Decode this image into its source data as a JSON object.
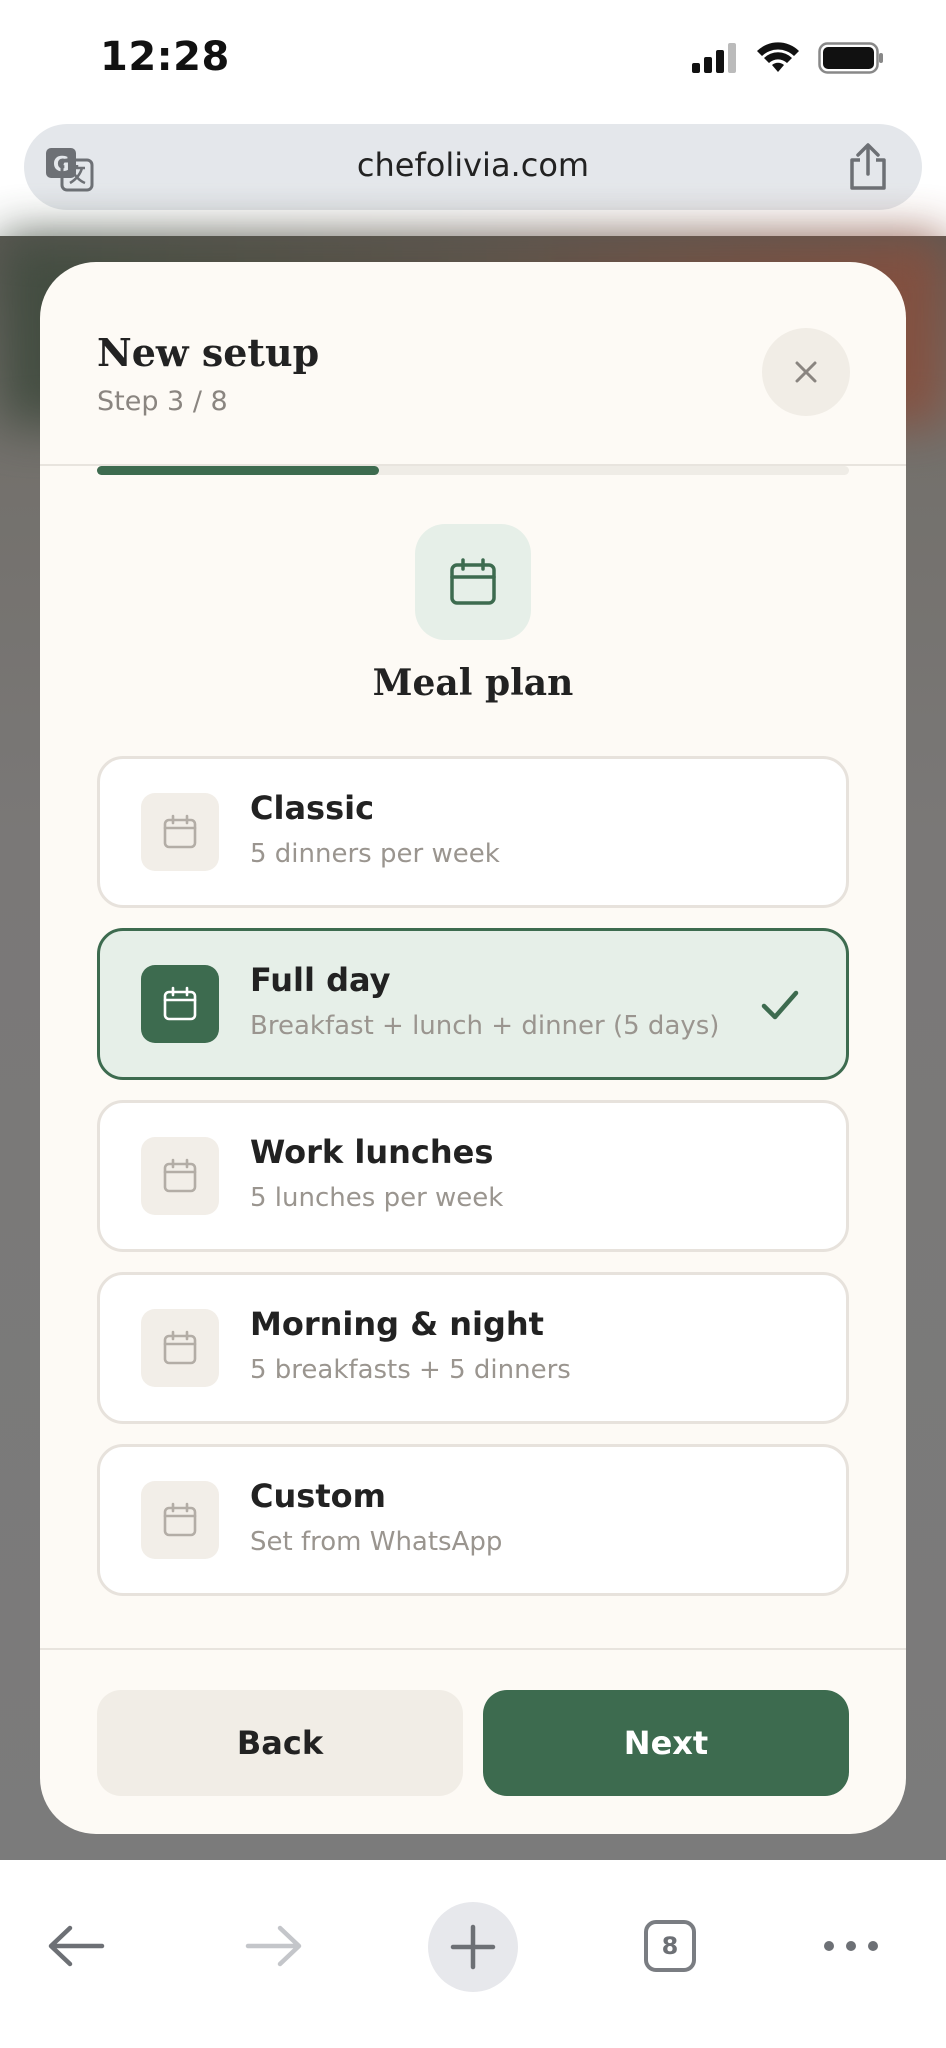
{
  "status_bar": {
    "time": "12:28"
  },
  "browser": {
    "url": "chefolivia.com",
    "tab_count": "8"
  },
  "modal": {
    "title": "New setup",
    "step": "Step 3 / 8",
    "progress_fraction": 0.375,
    "section_title": "Meal plan",
    "options": [
      {
        "title": "Classic",
        "subtitle": "5 dinners per week",
        "selected": false
      },
      {
        "title": "Full day",
        "subtitle": "Breakfast + lunch + dinner (5 days)",
        "selected": true
      },
      {
        "title": "Work lunches",
        "subtitle": "5 lunches per week",
        "selected": false
      },
      {
        "title": "Morning & night",
        "subtitle": "5 breakfasts + 5 dinners",
        "selected": false
      },
      {
        "title": "Custom",
        "subtitle": "Set from WhatsApp",
        "selected": false
      }
    ],
    "back_label": "Back",
    "next_label": "Next"
  },
  "colors": {
    "accent": "#3d6b4f",
    "accent_light": "#e6efe8",
    "modal_bg": "#fdfaf5"
  },
  "icons": {
    "close": "close-icon",
    "hero": "calendar-icon",
    "option": "calendar-icon",
    "selected_mark": "checkmark-icon"
  }
}
